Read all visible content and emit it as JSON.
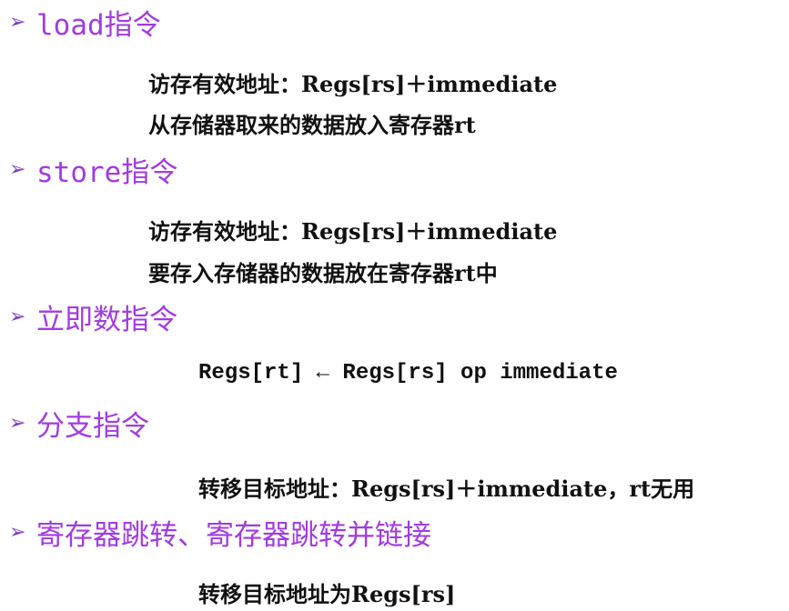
{
  "sections": [
    {
      "heading": "load指令",
      "lines": [
        "访存有效地址：Regs[rs]＋immediate",
        "从存储器取来的数据放入寄存器rt"
      ]
    },
    {
      "heading": "store指令",
      "lines": [
        "访存有效地址：Regs[rs]＋immediate",
        "要存入存储器的数据放在寄存器rt中"
      ]
    },
    {
      "heading": "立即数指令",
      "lines": [
        "Regs[rt] ← Regs[rs] op immediate"
      ]
    },
    {
      "heading": "分支指令",
      "lines": [
        "转移目标地址：Regs[rs]＋immediate，rt无用"
      ]
    },
    {
      "heading": "寄存器跳转、寄存器跳转并链接",
      "lines": [
        "转移目标地址为Regs[rs]"
      ]
    }
  ],
  "bullet_glyph": "➢",
  "colors": {
    "heading": "#a23be0",
    "bullet": "#7b3fbf",
    "body_text": "#111111"
  }
}
